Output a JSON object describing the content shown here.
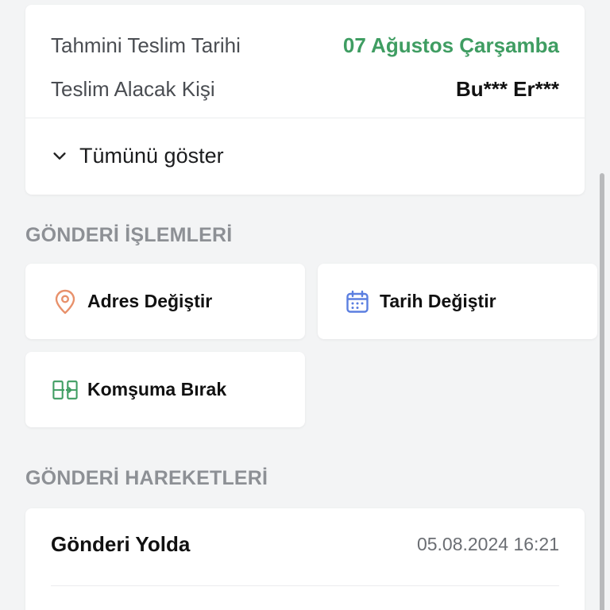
{
  "delivery": {
    "estimated_label": "Tahmini Teslim Tarihi",
    "estimated_value": "07 Ağustos Çarşamba",
    "recipient_label": "Teslim Alacak Kişi",
    "recipient_value": "Bu*** Er***",
    "show_all_label": "Tümünü göster"
  },
  "operations": {
    "title": "GÖNDERİ İŞLEMLERİ",
    "actions": [
      {
        "label": "Adres Değiştir",
        "icon": "location-pin-icon",
        "color": "#e8916b"
      },
      {
        "label": "Tarih Değiştir",
        "icon": "calendar-icon",
        "color": "#5b7fe0"
      },
      {
        "label": "Komşuma Bırak",
        "icon": "neighbor-transfer-icon",
        "color": "#3f9d62"
      }
    ]
  },
  "movements": {
    "title": "GÖNDERİ HAREKETLERİ",
    "items": [
      {
        "status": "Gönderi Yolda",
        "datetime": "05.08.2024 16:21"
      }
    ]
  },
  "colors": {
    "accent_green": "#3f9d62",
    "background": "#f3f4f5",
    "section_title": "#8d9095"
  }
}
